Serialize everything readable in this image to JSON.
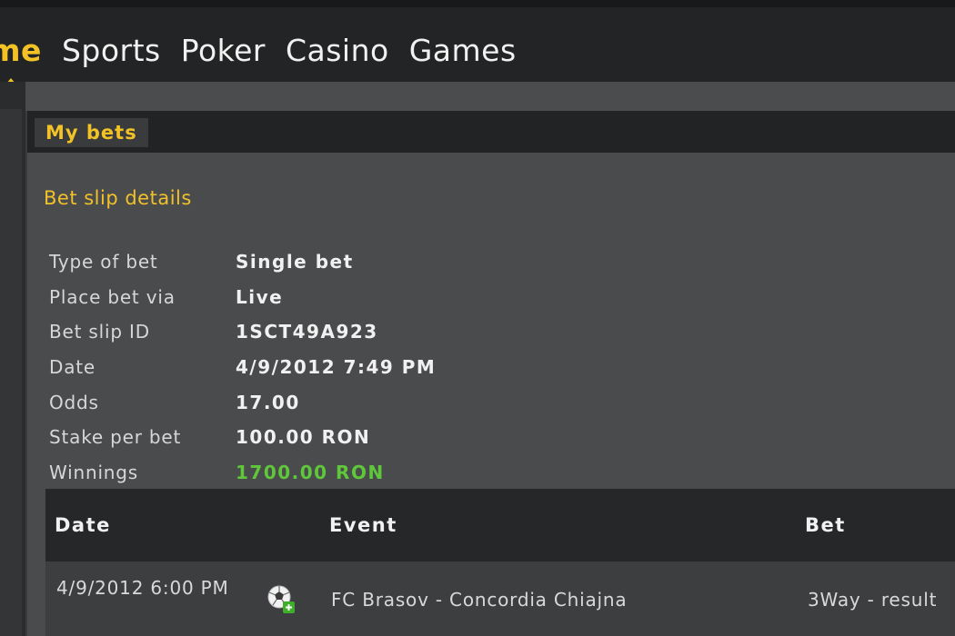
{
  "nav": {
    "items": [
      {
        "label": "ome",
        "active": true
      },
      {
        "label": "Sports",
        "active": false
      },
      {
        "label": "Poker",
        "active": false
      },
      {
        "label": "Casino",
        "active": false
      },
      {
        "label": "Games",
        "active": false
      }
    ]
  },
  "panel": {
    "title": "My bets",
    "section_title": "Bet slip details"
  },
  "details": [
    {
      "label": "Type of bet",
      "value": "Single bet"
    },
    {
      "label": "Place bet via",
      "value": "Live"
    },
    {
      "label": "Bet slip ID",
      "value": "1SCT49A923"
    },
    {
      "label": "Date",
      "value": "4/9/2012 7:49 PM"
    },
    {
      "label": "Odds",
      "value": "17.00"
    },
    {
      "label": "Stake per bet",
      "value": "100.00 RON"
    },
    {
      "label": "Winnings",
      "value": "1700.00 RON"
    }
  ],
  "table": {
    "headers": {
      "date": "Date",
      "event": "Event",
      "bet": "Bet"
    },
    "rows": [
      {
        "date": "4/9/2012 6:00 PM",
        "icon": "football-live-icon",
        "event": "FC Brasov - Concordia Chiajna",
        "bet": "3Way - result"
      }
    ]
  },
  "colors": {
    "accent": "#f3c326",
    "winnings": "#5fc83a",
    "topbar": "#232425",
    "panel": "#4a4b4d"
  }
}
